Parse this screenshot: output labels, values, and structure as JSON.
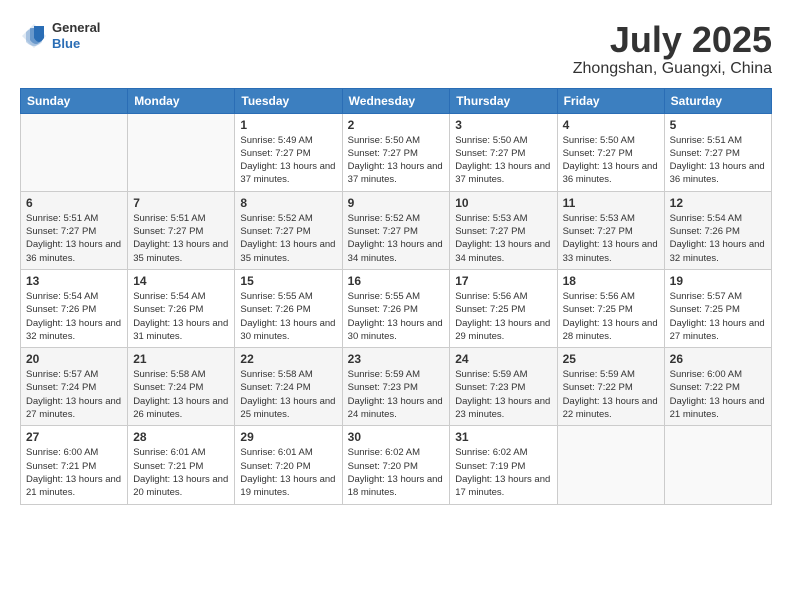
{
  "header": {
    "logo_general": "General",
    "logo_blue": "Blue",
    "month": "July 2025",
    "location": "Zhongshan, Guangxi, China"
  },
  "weekdays": [
    "Sunday",
    "Monday",
    "Tuesday",
    "Wednesday",
    "Thursday",
    "Friday",
    "Saturday"
  ],
  "weeks": [
    [
      {
        "day": "",
        "info": ""
      },
      {
        "day": "",
        "info": ""
      },
      {
        "day": "1",
        "info": "Sunrise: 5:49 AM\nSunset: 7:27 PM\nDaylight: 13 hours and 37 minutes."
      },
      {
        "day": "2",
        "info": "Sunrise: 5:50 AM\nSunset: 7:27 PM\nDaylight: 13 hours and 37 minutes."
      },
      {
        "day": "3",
        "info": "Sunrise: 5:50 AM\nSunset: 7:27 PM\nDaylight: 13 hours and 37 minutes."
      },
      {
        "day": "4",
        "info": "Sunrise: 5:50 AM\nSunset: 7:27 PM\nDaylight: 13 hours and 36 minutes."
      },
      {
        "day": "5",
        "info": "Sunrise: 5:51 AM\nSunset: 7:27 PM\nDaylight: 13 hours and 36 minutes."
      }
    ],
    [
      {
        "day": "6",
        "info": "Sunrise: 5:51 AM\nSunset: 7:27 PM\nDaylight: 13 hours and 36 minutes."
      },
      {
        "day": "7",
        "info": "Sunrise: 5:51 AM\nSunset: 7:27 PM\nDaylight: 13 hours and 35 minutes."
      },
      {
        "day": "8",
        "info": "Sunrise: 5:52 AM\nSunset: 7:27 PM\nDaylight: 13 hours and 35 minutes."
      },
      {
        "day": "9",
        "info": "Sunrise: 5:52 AM\nSunset: 7:27 PM\nDaylight: 13 hours and 34 minutes."
      },
      {
        "day": "10",
        "info": "Sunrise: 5:53 AM\nSunset: 7:27 PM\nDaylight: 13 hours and 34 minutes."
      },
      {
        "day": "11",
        "info": "Sunrise: 5:53 AM\nSunset: 7:27 PM\nDaylight: 13 hours and 33 minutes."
      },
      {
        "day": "12",
        "info": "Sunrise: 5:54 AM\nSunset: 7:26 PM\nDaylight: 13 hours and 32 minutes."
      }
    ],
    [
      {
        "day": "13",
        "info": "Sunrise: 5:54 AM\nSunset: 7:26 PM\nDaylight: 13 hours and 32 minutes."
      },
      {
        "day": "14",
        "info": "Sunrise: 5:54 AM\nSunset: 7:26 PM\nDaylight: 13 hours and 31 minutes."
      },
      {
        "day": "15",
        "info": "Sunrise: 5:55 AM\nSunset: 7:26 PM\nDaylight: 13 hours and 30 minutes."
      },
      {
        "day": "16",
        "info": "Sunrise: 5:55 AM\nSunset: 7:26 PM\nDaylight: 13 hours and 30 minutes."
      },
      {
        "day": "17",
        "info": "Sunrise: 5:56 AM\nSunset: 7:25 PM\nDaylight: 13 hours and 29 minutes."
      },
      {
        "day": "18",
        "info": "Sunrise: 5:56 AM\nSunset: 7:25 PM\nDaylight: 13 hours and 28 minutes."
      },
      {
        "day": "19",
        "info": "Sunrise: 5:57 AM\nSunset: 7:25 PM\nDaylight: 13 hours and 27 minutes."
      }
    ],
    [
      {
        "day": "20",
        "info": "Sunrise: 5:57 AM\nSunset: 7:24 PM\nDaylight: 13 hours and 27 minutes."
      },
      {
        "day": "21",
        "info": "Sunrise: 5:58 AM\nSunset: 7:24 PM\nDaylight: 13 hours and 26 minutes."
      },
      {
        "day": "22",
        "info": "Sunrise: 5:58 AM\nSunset: 7:24 PM\nDaylight: 13 hours and 25 minutes."
      },
      {
        "day": "23",
        "info": "Sunrise: 5:59 AM\nSunset: 7:23 PM\nDaylight: 13 hours and 24 minutes."
      },
      {
        "day": "24",
        "info": "Sunrise: 5:59 AM\nSunset: 7:23 PM\nDaylight: 13 hours and 23 minutes."
      },
      {
        "day": "25",
        "info": "Sunrise: 5:59 AM\nSunset: 7:22 PM\nDaylight: 13 hours and 22 minutes."
      },
      {
        "day": "26",
        "info": "Sunrise: 6:00 AM\nSunset: 7:22 PM\nDaylight: 13 hours and 21 minutes."
      }
    ],
    [
      {
        "day": "27",
        "info": "Sunrise: 6:00 AM\nSunset: 7:21 PM\nDaylight: 13 hours and 21 minutes."
      },
      {
        "day": "28",
        "info": "Sunrise: 6:01 AM\nSunset: 7:21 PM\nDaylight: 13 hours and 20 minutes."
      },
      {
        "day": "29",
        "info": "Sunrise: 6:01 AM\nSunset: 7:20 PM\nDaylight: 13 hours and 19 minutes."
      },
      {
        "day": "30",
        "info": "Sunrise: 6:02 AM\nSunset: 7:20 PM\nDaylight: 13 hours and 18 minutes."
      },
      {
        "day": "31",
        "info": "Sunrise: 6:02 AM\nSunset: 7:19 PM\nDaylight: 13 hours and 17 minutes."
      },
      {
        "day": "",
        "info": ""
      },
      {
        "day": "",
        "info": ""
      }
    ]
  ]
}
